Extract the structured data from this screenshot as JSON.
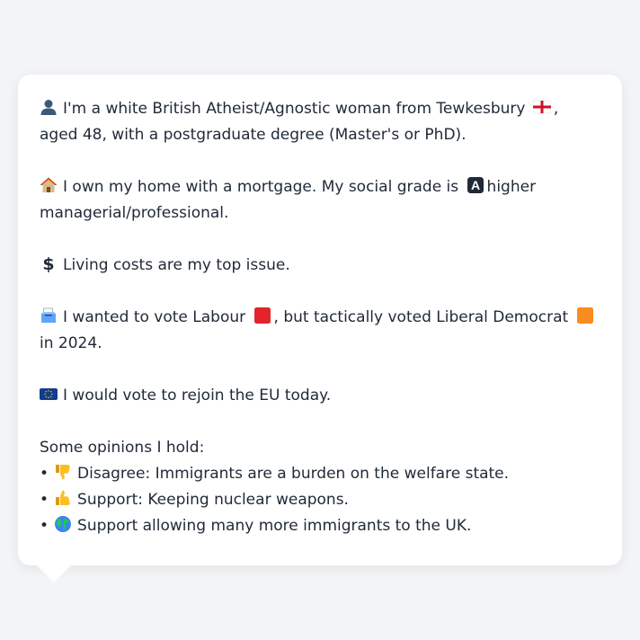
{
  "profile": {
    "identity": {
      "icon": "person-silhouette-icon",
      "text_before_flag": "I'm a white British Atheist/Agnostic woman from Tewkesbury",
      "flag_icon": "england-flag-icon",
      "text_after_flag": ", aged 48, with a postgraduate degree (Master's or PhD)."
    },
    "home": {
      "icon": "house-icon",
      "text_before_grade": "I own my home with a mortgage. My social grade is",
      "grade_icon": "letter-a-button-icon",
      "grade_letter": "A",
      "text_after_grade": "higher managerial/professional."
    },
    "issue": {
      "icon": "dollar-sign-icon",
      "text": "Living costs are my top issue."
    },
    "vote": {
      "icon": "ballot-box-icon",
      "text_part1": "I wanted to vote Labour",
      "labour_icon": "red-square-icon",
      "text_part2": ", but tactically voted Liberal Democrat",
      "libdem_icon": "orange-square-icon",
      "text_part3": "in 2024."
    },
    "eu": {
      "icon": "eu-flag-icon",
      "text": "I would vote to rejoin the EU today."
    },
    "opinions": {
      "heading": "Some opinions I hold:",
      "bullet": "•",
      "items": [
        {
          "icon": "thumbs-down-icon",
          "text": "Disagree: Immigrants are a burden on the welfare state."
        },
        {
          "icon": "thumbs-up-icon",
          "text": "Support: Keeping nuclear weapons."
        },
        {
          "icon": "globe-icon",
          "text": "Support allowing many more immigrants to the UK."
        }
      ]
    }
  },
  "colors": {
    "background": "#f3f4f6",
    "card": "#ffffff",
    "text": "#1f2937",
    "labour_red": "#e3242b",
    "libdem_orange": "#fa8b1f",
    "eu_blue": "#103d91",
    "eu_gold": "#f6c80a"
  }
}
